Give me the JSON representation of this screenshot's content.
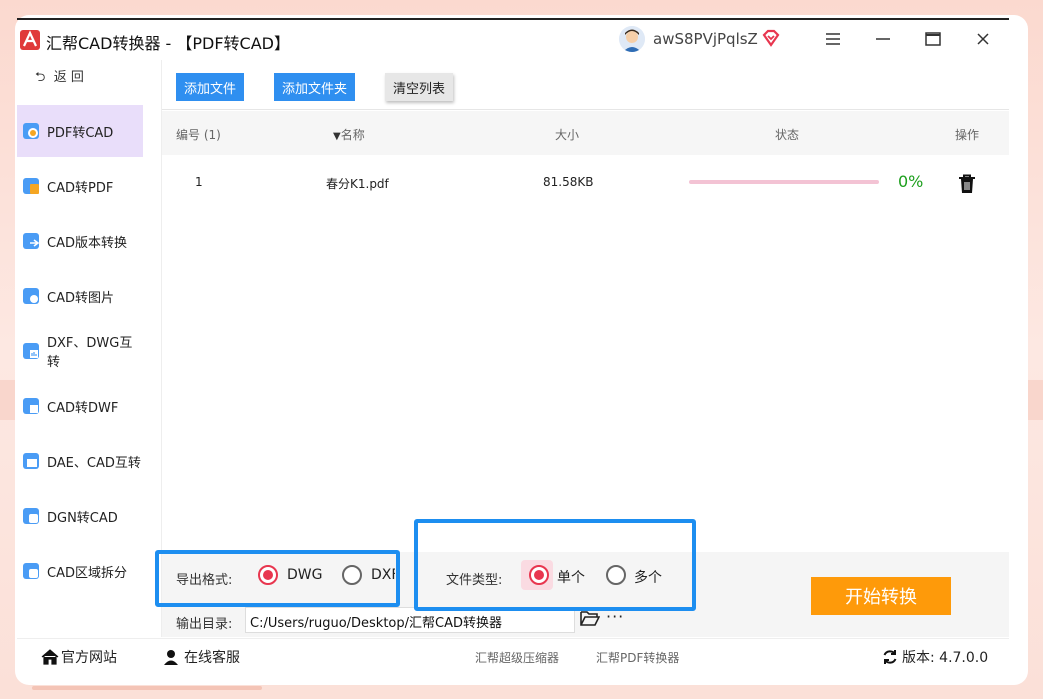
{
  "window": {
    "title": "汇帮CAD转换器 - 【PDF转CAD】",
    "username": "awS8PVjPqlsZ",
    "controls": [
      "menu-icon",
      "minimize-icon",
      "maximize-icon",
      "close-icon"
    ]
  },
  "sidebar": {
    "back_label": "返 回",
    "items": [
      {
        "label": "PDF转CAD",
        "icon": "pdf-to-cad-icon",
        "active": true
      },
      {
        "label": "CAD转PDF",
        "icon": "cad-to-pdf-icon"
      },
      {
        "label": "CAD版本转换",
        "icon": "cad-version-icon"
      },
      {
        "label": "CAD转图片",
        "icon": "cad-to-image-icon"
      },
      {
        "label": "DXF、DWG互转",
        "icon": "dxf-dwg-icon"
      },
      {
        "label": "CAD转DWF",
        "icon": "cad-to-dwf-icon"
      },
      {
        "label": "DAE、CAD互转",
        "icon": "dae-cad-icon"
      },
      {
        "label": "DGN转CAD",
        "icon": "dgn-to-cad-icon"
      },
      {
        "label": "CAD区域拆分",
        "icon": "cad-split-icon"
      }
    ]
  },
  "toolbar": {
    "add_file": "添加文件",
    "add_folder": "添加文件夹",
    "clear_list": "清空列表"
  },
  "table": {
    "columns": {
      "index": "编号 (1)",
      "name": "名称",
      "size": "大小",
      "status": "状态",
      "actions": "操作"
    },
    "rows": [
      {
        "index": "1",
        "name": "春分K1.pdf",
        "size": "81.58KB",
        "progress": 0,
        "percent": "0%"
      }
    ]
  },
  "options": {
    "format_label": "导出格式:",
    "format_options": [
      "DWG",
      "DXF"
    ],
    "format_selected": "DWG",
    "type_label": "文件类型:",
    "type_options": [
      "单个",
      "多个"
    ],
    "type_selected": "单个",
    "output_label": "输出目录:",
    "output_path": "C:/Users/ruguo/Desktop/汇帮CAD转换器",
    "more": "···"
  },
  "start_button": "开始转换",
  "statusbar": {
    "website": "官方网站",
    "support": "在线客服",
    "link1": "汇帮超级压缩器",
    "link2": "汇帮PDF转换器",
    "version": "版本:  4.7.0.0"
  },
  "colors": {
    "accent": "#2f8ff0",
    "start": "#fe9a0a",
    "radio_on": "#e8364f",
    "active_nav": "#e9defa",
    "percent": "#1d9f1d",
    "highlight": "#1d8ef0"
  }
}
